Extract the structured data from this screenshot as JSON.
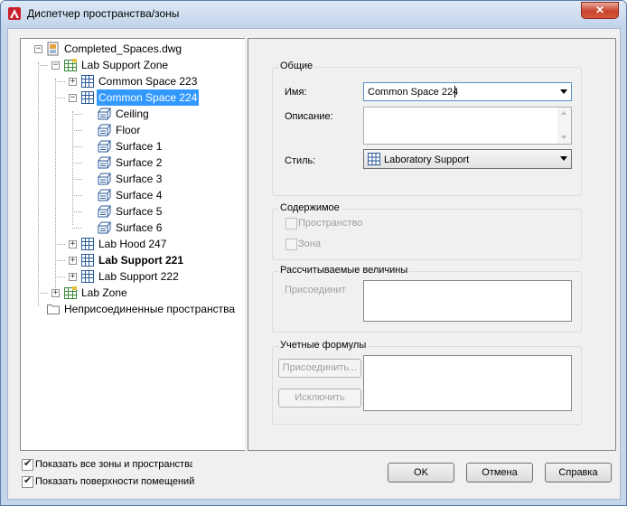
{
  "window": {
    "title": "Диспетчер пространства/зоны",
    "close_glyph": "✕"
  },
  "tree": {
    "items": [
      {
        "label": "Completed_Spaces.dwg",
        "icon": "dwg-file-icon",
        "expander": "−"
      },
      {
        "label": "Lab Support Zone",
        "icon": "zone-icon",
        "expander": "−"
      },
      {
        "label": "Common Space 223",
        "icon": "space-icon",
        "expander": "+"
      },
      {
        "label": "Common Space 224",
        "icon": "space-icon",
        "expander": "−",
        "selected": true
      },
      {
        "label": "Ceiling",
        "icon": "surface-icon"
      },
      {
        "label": "Floor",
        "icon": "surface-icon"
      },
      {
        "label": "Surface 1",
        "icon": "surface-icon"
      },
      {
        "label": "Surface 2",
        "icon": "surface-icon"
      },
      {
        "label": "Surface 3",
        "icon": "surface-icon"
      },
      {
        "label": "Surface 4",
        "icon": "surface-icon"
      },
      {
        "label": "Surface 5",
        "icon": "surface-icon"
      },
      {
        "label": "Surface 6",
        "icon": "surface-icon"
      },
      {
        "label": "Lab Hood 247",
        "icon": "space-icon",
        "expander": "+"
      },
      {
        "label": "Lab Support 221",
        "icon": "space-icon",
        "expander": "+",
        "bold": true
      },
      {
        "label": "Lab Support 222",
        "icon": "space-icon",
        "expander": "+"
      },
      {
        "label": "Lab Zone",
        "icon": "zone-icon",
        "expander": "+"
      },
      {
        "label": "Неприсоединенные пространства",
        "icon": "folder-icon"
      }
    ]
  },
  "general": {
    "title": "Общие",
    "name_label": "Имя:",
    "name_value": "Common Space 224",
    "description_label": "Описание:",
    "description_value": "",
    "style_label": "Стиль:",
    "style_value": "Laboratory Support"
  },
  "contents": {
    "title": "Содержимое",
    "space_label": "Пространство",
    "space_checked": false,
    "zone_label": "Зона",
    "zone_checked": false
  },
  "calculated": {
    "title": "Рассчитываемые величины",
    "attach_label": "Присоединит"
  },
  "formulas": {
    "title": "Учетные формулы",
    "attach_button": "Присоединить...",
    "exclude_button": "Исключить"
  },
  "options": {
    "show_all_label": "Показать все зоны и пространства",
    "show_all_checked": true,
    "show_surfaces_label": "Показать поверхности помещений",
    "show_surfaces_checked": true,
    "check_glyph": "✔"
  },
  "footer": {
    "ok": "OK",
    "cancel": "Отмена",
    "help": "Справка"
  },
  "colors": {
    "selection": "#3399ff",
    "title_gradient_top": "#dfe9f6",
    "close_button": "#c9432d"
  }
}
